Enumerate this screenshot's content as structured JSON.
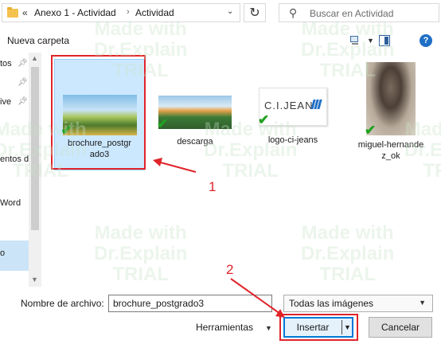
{
  "addressbar": {
    "lead_chevrons": "«",
    "crumbs": [
      "Anexo 1 - Actividad",
      "Actividad"
    ],
    "separator": "›",
    "refresh_glyph": "↻",
    "search_placeholder": "Buscar en Actividad",
    "dropdown_glyph": "⌄"
  },
  "toolbar": {
    "new_folder": "Nueva carpeta",
    "help": "?"
  },
  "nav": {
    "items": [
      "tos",
      "",
      "ive",
      "entos d",
      "Word"
    ],
    "selected": "o"
  },
  "files": [
    {
      "name": "brochure_postgrado3",
      "line1": "brochure_postgr",
      "line2": "ado3",
      "selected": true
    },
    {
      "name": "descarga",
      "line1": "descarga",
      "line2": "",
      "selected": false
    },
    {
      "name": "logo-ci-jeans",
      "line1": "logo-ci-jeans",
      "line2": "",
      "selected": false,
      "logo_text": "C.I.JEANS"
    },
    {
      "name": "miguel-hernandez_ok",
      "line1": "miguel-hernande",
      "line2": "z_ok",
      "selected": false
    }
  ],
  "bottom": {
    "filename_label": "Nombre de archivo:",
    "filename_value": "brochure_postgrado3",
    "filter_value": "Todas las imágenes",
    "tools_label": "Herramientas",
    "insert_label": "Insertar",
    "cancel_label": "Cancelar"
  },
  "annotations": {
    "num1": "1",
    "num2": "2",
    "color": "#e0242a"
  },
  "watermark": {
    "lines": [
      "Made with",
      "Dr.Explain",
      "TRIAL"
    ]
  },
  "colors": {
    "accent": "#0078d7",
    "selection": "#cce8ff",
    "check": "#21a121"
  }
}
